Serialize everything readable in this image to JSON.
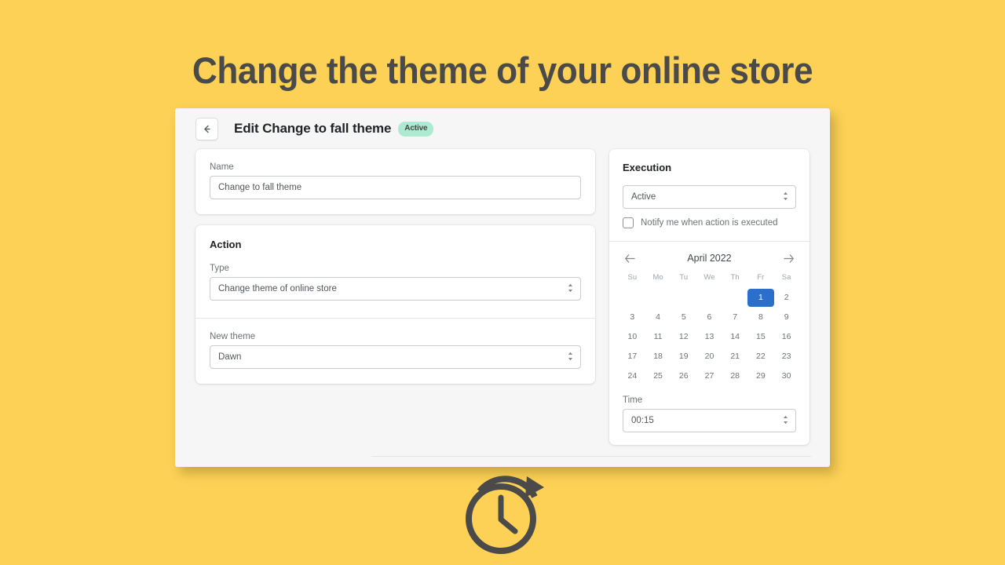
{
  "headline": "Change the theme of your online store",
  "colors": {
    "background": "#fcd155",
    "window_bg": "#f6f6f7",
    "card_bg": "#ffffff",
    "badge_bg": "#aee9d1",
    "selected_day": "#2c6ecb",
    "text_dark": "#4a4a4a"
  },
  "topbar": {
    "back_icon": "arrow-left-icon",
    "title": "Edit Change to fall theme",
    "badge": "Active"
  },
  "name_card": {
    "label": "Name",
    "value": "Change to fall theme",
    "placeholder": "Name"
  },
  "action_card": {
    "title": "Action",
    "type": {
      "label": "Type",
      "value": "Change theme of online store"
    },
    "new_theme": {
      "label": "New theme",
      "value": "Dawn"
    }
  },
  "execution": {
    "title": "Execution",
    "status": {
      "value": "Active"
    },
    "notify": {
      "label": "Notify me when action is executed",
      "checked": false
    }
  },
  "calendar": {
    "prev_icon": "arrow-left-icon",
    "next_icon": "arrow-right-icon",
    "month": "April 2022",
    "weekdays": [
      "Su",
      "Mo",
      "Tu",
      "We",
      "Th",
      "Fr",
      "Sa"
    ],
    "weeks": [
      [
        "",
        "",
        "",
        "",
        "",
        "1",
        "2"
      ],
      [
        "3",
        "4",
        "5",
        "6",
        "7",
        "8",
        "9"
      ],
      [
        "10",
        "11",
        "12",
        "13",
        "14",
        "15",
        "16"
      ],
      [
        "17",
        "18",
        "19",
        "20",
        "21",
        "22",
        "23"
      ],
      [
        "24",
        "25",
        "26",
        "27",
        "28",
        "29",
        "30"
      ]
    ],
    "selected_day": "1"
  },
  "time": {
    "label": "Time",
    "value": "00:15"
  },
  "footer": {
    "icon": "clock-arrow-icon"
  }
}
